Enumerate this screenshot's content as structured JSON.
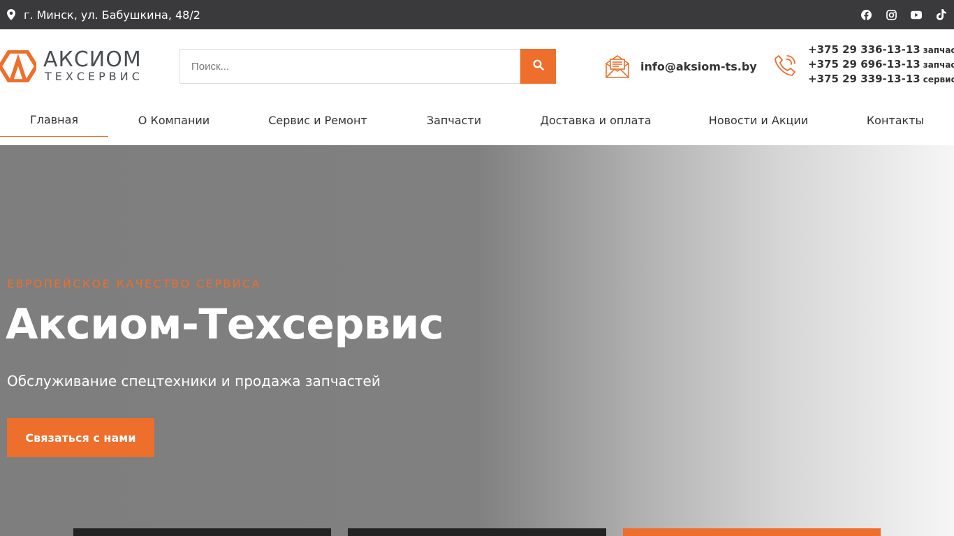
{
  "topbar": {
    "address": "г. Минск, ул. Бабушкина, 48/2",
    "address_icon": "map-pin-icon",
    "socials": [
      {
        "name": "facebook-icon"
      },
      {
        "name": "instagram-icon"
      },
      {
        "name": "youtube-icon"
      },
      {
        "name": "tiktok-icon"
      }
    ]
  },
  "header": {
    "logo": {
      "name": "АКСИОМ",
      "sub": "ТЕХСЕРВИС"
    },
    "search": {
      "placeholder": "Поиск..."
    },
    "email": "info@aksiom-ts.by",
    "phones": [
      {
        "number": "+375 29 336-13-13",
        "tag": "запчасти"
      },
      {
        "number": "+375 29 696-13-13",
        "tag": "запчасти"
      },
      {
        "number": "+375 29 339-13-13",
        "tag": "сервис"
      }
    ]
  },
  "nav": {
    "items": [
      {
        "label": "Главная",
        "active": true
      },
      {
        "label": "О Компании"
      },
      {
        "label": "Сервис и Ремонт"
      },
      {
        "label": "Запчасти"
      },
      {
        "label": "Доставка и оплата"
      },
      {
        "label": "Новости и Акции"
      },
      {
        "label": "Контакты"
      }
    ]
  },
  "hero": {
    "eyebrow": "ЕВРОПЕЙСКОЕ КАЧЕСТВО СЕРВИСА",
    "title": "Аксиом-Техсервис",
    "subtitle": "Обслуживание спецтехники и продажа запчастей",
    "cta": "Связаться с нами"
  },
  "colors": {
    "accent": "#ee6e2b",
    "topbar": "#3a3a3c",
    "text": "#333333"
  }
}
